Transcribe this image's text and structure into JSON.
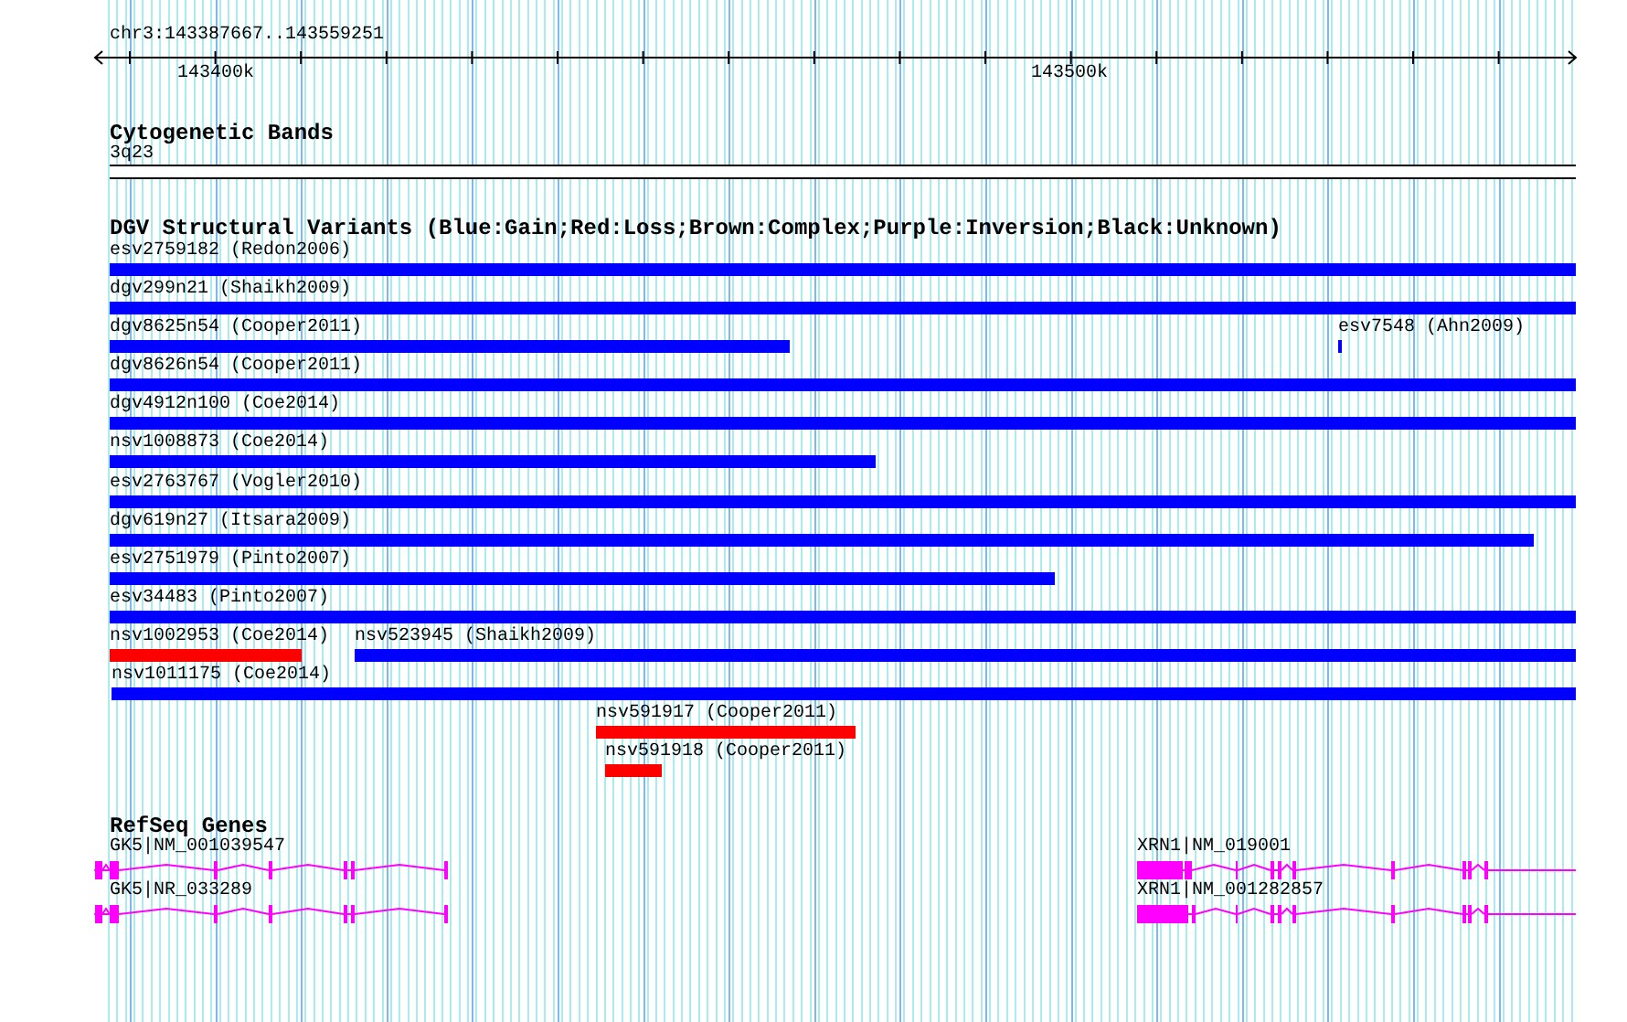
{
  "ruler": {
    "location": "chr3:143387667..143559251",
    "tick_labels": [
      "143400k",
      "143500k"
    ]
  },
  "cytogenetic_bands": {
    "title": "Cytogenetic Bands",
    "band": "3q23"
  },
  "structural_variants": {
    "title": "DGV Structural Variants (Blue:Gain;Red:Loss;Brown:Complex;Purple:Inversion;Black:Unknown)",
    "rows": [
      {
        "features": [
          {
            "label": "esv2759182 (Redon2006)",
            "color": "#0000ff"
          }
        ]
      },
      {
        "features": [
          {
            "label": "dgv299n21 (Shaikh2009)",
            "color": "#0000ff"
          }
        ]
      },
      {
        "features": [
          {
            "label": "dgv8625n54 (Cooper2011)",
            "color": "#0000ff"
          },
          {
            "label": "esv7548 (Ahn2009)",
            "color": "#0000ff"
          }
        ]
      },
      {
        "features": [
          {
            "label": "dgv8626n54 (Cooper2011)",
            "color": "#0000ff"
          }
        ]
      },
      {
        "features": [
          {
            "label": "dgv4912n100 (Coe2014)",
            "color": "#0000ff"
          }
        ]
      },
      {
        "features": [
          {
            "label": "nsv1008873 (Coe2014)",
            "color": "#0000ff"
          }
        ]
      },
      {
        "features": [
          {
            "label": "esv2763767 (Vogler2010)",
            "color": "#0000ff"
          }
        ]
      },
      {
        "features": [
          {
            "label": "dgv619n27 (Itsara2009)",
            "color": "#0000ff"
          }
        ]
      },
      {
        "features": [
          {
            "label": "esv2751979 (Pinto2007)",
            "color": "#0000ff"
          }
        ]
      },
      {
        "features": [
          {
            "label": "esv34483 (Pinto2007)",
            "color": "#0000ff"
          }
        ]
      },
      {
        "features": [
          {
            "label": "nsv1002953 (Coe2014)",
            "color": "#ff0000"
          },
          {
            "label": "nsv523945 (Shaikh2009)",
            "color": "#0000ff"
          }
        ]
      },
      {
        "features": [
          {
            "label": "nsv1011175 (Coe2014)",
            "color": "#0000ff"
          }
        ]
      },
      {
        "features": [
          {
            "label": "nsv591917 (Cooper2011)",
            "color": "#ff0000"
          }
        ]
      },
      {
        "features": [
          {
            "label": "nsv591918 (Cooper2011)",
            "color": "#ff0000"
          }
        ]
      }
    ]
  },
  "refseq_genes": {
    "title": "RefSeq Genes",
    "transcripts": [
      {
        "label": "GK5|NM_001039547"
      },
      {
        "label": "XRN1|NM_019001"
      },
      {
        "label": "GK5|NR_033289"
      },
      {
        "label": "XRN1|NM_001282857"
      }
    ]
  }
}
